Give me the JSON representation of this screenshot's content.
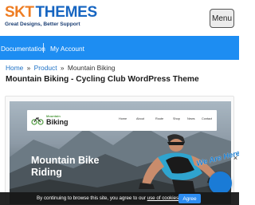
{
  "header": {
    "logo_part1": "SKT",
    "logo_part2": "THEMES",
    "tagline": "Great Designs, Better Support",
    "menu_label": "Menu"
  },
  "nav": {
    "items": [
      {
        "label": "Documentation"
      },
      {
        "label": "My Account"
      }
    ]
  },
  "breadcrumb": {
    "home": "Home",
    "separator": "»",
    "category": "Product",
    "current": "Mountain Biking"
  },
  "page_title": "Mountain Biking - Cycling Club WordPress Theme",
  "preview": {
    "logo_small": "Mountain",
    "logo_big": "Biking",
    "menu": [
      "Home",
      "About",
      "Route",
      "Shop",
      "News",
      "Contact"
    ],
    "hero_line1": "Mountain Bike",
    "hero_line2": "Riding"
  },
  "cookie": {
    "text_before": "By continuing to browse this site, you agree to our",
    "link": "use of cookies",
    "text_after": ".",
    "agree_label": "Agree"
  },
  "chat": {
    "label": "We Are Here!",
    "close": "×"
  },
  "colors": {
    "brand_orange": "#ee7d23",
    "brand_blue": "#1665c1",
    "nav_blue": "#1d8df2",
    "link_blue": "#1d71c6"
  }
}
